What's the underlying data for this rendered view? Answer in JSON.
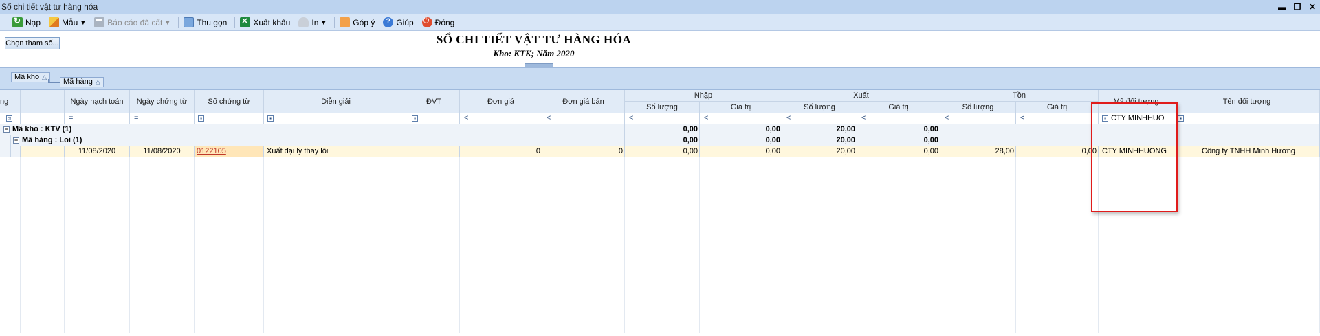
{
  "window": {
    "title": "Sổ chi tiết vật tư hàng hóa"
  },
  "toolbar": {
    "reload": "Nạp",
    "template": "Mẫu",
    "saved_reports": "Báo cáo đã cất",
    "collapse": "Thu gọn",
    "export": "Xuất khẩu",
    "print": "In",
    "feedback": "Góp ý",
    "help": "Giúp",
    "close": "Đóng"
  },
  "report": {
    "param_button": "Chọn tham số...",
    "title": "SỔ CHI TIẾT VẬT TƯ HÀNG HÓA",
    "subtitle": "Kho: KTK; Năm 2020"
  },
  "group_panel": {
    "chips": [
      "Mã kho",
      "Mã hàng"
    ]
  },
  "grid": {
    "columns": {
      "c0": "ng",
      "ngay_hach_toan": "Ngày hạch toán",
      "ngay_chung_tu": "Ngày chứng từ",
      "so_chung_tu": "Số chứng từ",
      "dien_giai": "Diễn giải",
      "dvt": "ĐVT",
      "don_gia": "Đơn giá",
      "don_gia_ban": "Đơn giá bán",
      "nhap": "Nhập",
      "xuat": "Xuất",
      "ton": "Tồn",
      "so_luong": "Số lượng",
      "gia_tri": "Giá trị",
      "ma_doi_tuong": "Mã đối tượng",
      "ten_doi_tuong": "Tên đối tượng"
    },
    "filter": {
      "eq": "=",
      "le": "≤",
      "ma_doi_tuong_value": "CTY MINHHUO"
    },
    "group1": {
      "label": "Mã kho : KTV (1)",
      "nhap_sl": "0,00",
      "nhap_gt": "0,00",
      "xuat_sl": "20,00",
      "xuat_gt": "0,00"
    },
    "group2": {
      "label": "Mã hàng : Loi (1)",
      "nhap_sl": "0,00",
      "nhap_gt": "0,00",
      "xuat_sl": "20,00",
      "xuat_gt": "0,00"
    },
    "row": {
      "ngay_hach_toan": "11/08/2020",
      "ngay_chung_tu": "11/08/2020",
      "so_chung_tu": "0122105",
      "dien_giai": "Xuất đại lý thay lõi",
      "dvt": "",
      "don_gia": "0",
      "don_gia_ban": "0",
      "nhap_sl": "0,00",
      "nhap_gt": "0,00",
      "xuat_sl": "20,00",
      "xuat_gt": "0,00",
      "ton_sl": "28,00",
      "ton_gt": "0,00",
      "ma_doi_tuong": "CTY MINHHUONG",
      "ten_doi_tuong": "Công ty TNHH Minh Hương"
    }
  }
}
